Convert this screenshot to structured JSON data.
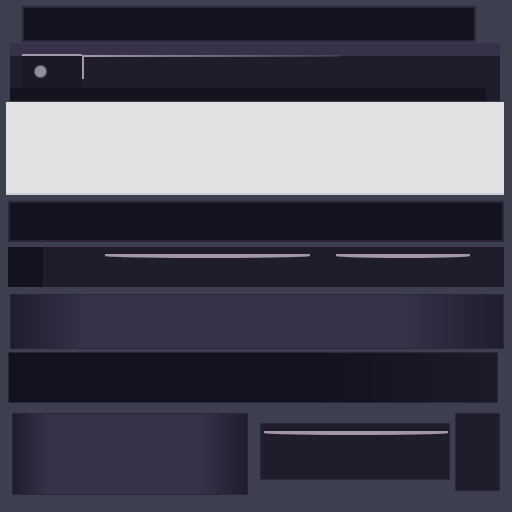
{
  "window": {
    "title": ""
  },
  "toolbar": {
    "active_tab_label": "",
    "record_indicator": "record-dot-icon"
  },
  "content": {
    "text": ""
  },
  "address_bar": {
    "value": ""
  },
  "controls": {
    "slider_1_label": "",
    "slider_2_label": ""
  },
  "colors": {
    "background": "#3d3f4f",
    "panel_dark": "#13121f",
    "panel_mid": "#1f1d2c",
    "accent_purple": "#38314a",
    "highlight": "#a497a6",
    "content_light": "#e2e2e5"
  }
}
